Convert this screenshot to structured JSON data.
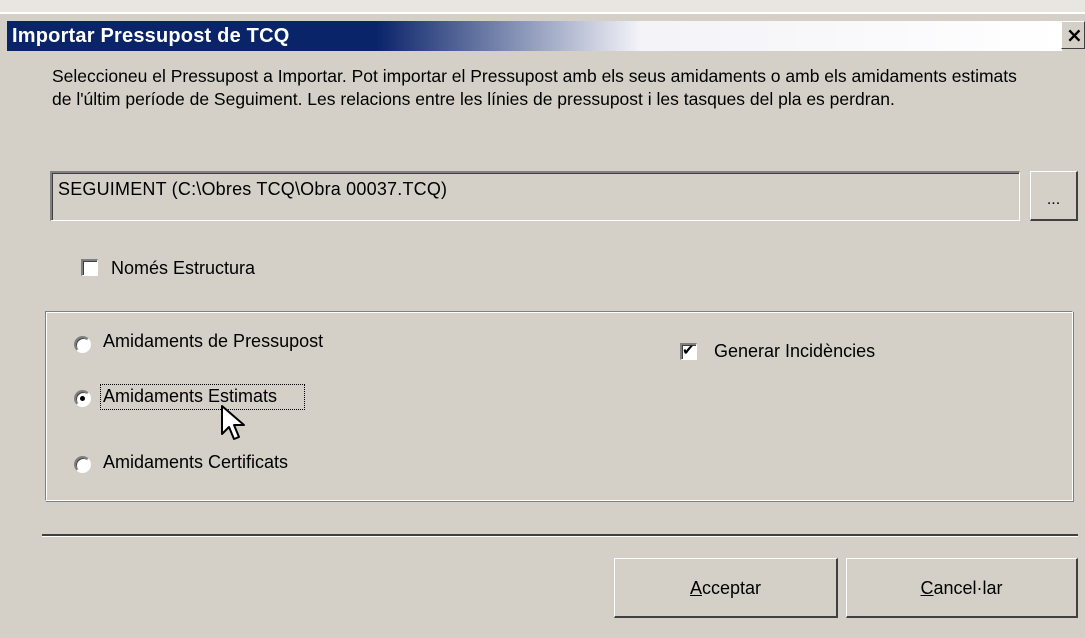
{
  "window": {
    "title": "Importar Pressupost de TCQ",
    "close_glyph": "×"
  },
  "description": "Seleccioneu el Pressupost a Importar. Pot importar el Pressupost amb els seus amidaments o amb els amidaments estimats de l'últim període de Seguiment. Les relacions entre les línies de pressupost i les tasques del pla es perdran.",
  "file": {
    "value": "SEGUIMENT (C:\\Obres TCQ\\Obra 00037.TCQ)",
    "browse_label": "..."
  },
  "only_structure": {
    "label": "Només Estructura",
    "checked": false
  },
  "measurements": {
    "options": [
      {
        "label": "Amidaments de Pressupost",
        "selected": false
      },
      {
        "label": "Amidaments Estimats",
        "selected": true
      },
      {
        "label": "Amidaments Certificats",
        "selected": false
      }
    ]
  },
  "generate_incidents": {
    "label": "Generar Incidències",
    "checked": true
  },
  "buttons": {
    "accept_mnemonic": "A",
    "accept_rest": "cceptar",
    "cancel_mnemonic": "C",
    "cancel_rest": "ancel·lar"
  },
  "icons": {
    "check": "✔",
    "cursor": "arrow-pointer-icon"
  },
  "colors": {
    "title_bar": "#0a246a",
    "face": "#d4d0c8"
  }
}
